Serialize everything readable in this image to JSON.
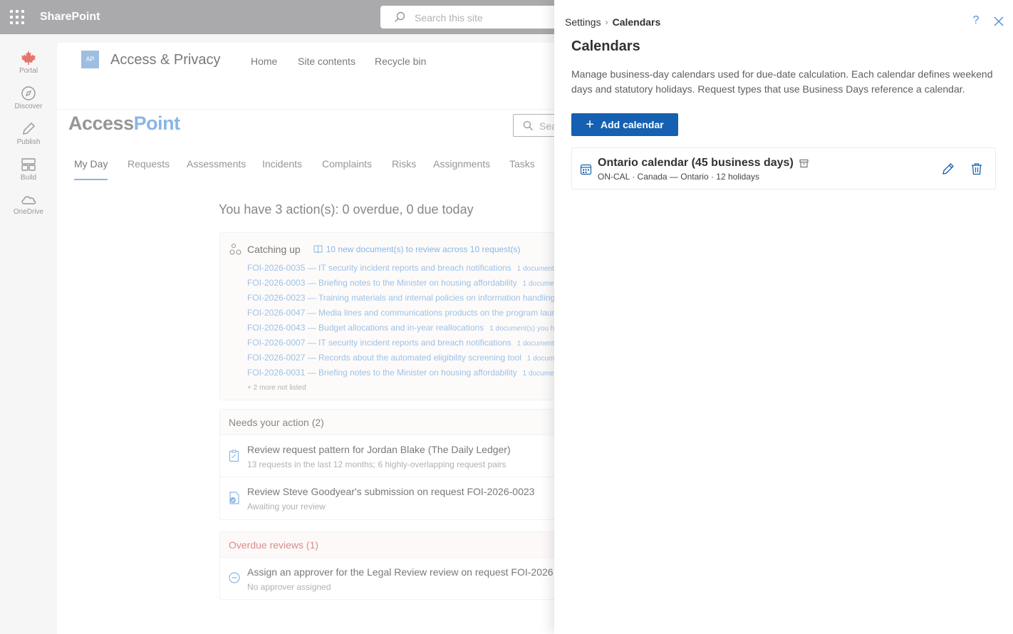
{
  "suite": {
    "brand": "SharePoint",
    "search_placeholder": "Search this site"
  },
  "rail": [
    {
      "label": "Portal",
      "icon": "maple-leaf-icon"
    },
    {
      "label": "Discover",
      "icon": "compass-icon"
    },
    {
      "label": "Publish",
      "icon": "pen-icon"
    },
    {
      "label": "Build",
      "icon": "layout-icon"
    },
    {
      "label": "OneDrive",
      "icon": "cloud-icon"
    }
  ],
  "site": {
    "logo_initials": "AP",
    "title": "Access & Privacy",
    "nav": [
      "Home",
      "Site contents",
      "Recycle bin"
    ],
    "app_logo_part1": "Access",
    "app_logo_part2": "Point",
    "inner_search_placeholder": "Sea",
    "tabs": [
      "My Day",
      "Requests",
      "Assessments",
      "Incidents",
      "Complaints",
      "Risks",
      "Assignments",
      "Tasks"
    ],
    "active_tab": "My Day",
    "summary": "You have 3 action(s): 0 overdue, 0 due today",
    "catching_up": {
      "title": "Catching up",
      "link": "10 new document(s) to review across 10 request(s)",
      "items": [
        {
          "text": "FOI-2026-0035 — IT security incident reports and breach notifications",
          "meta": "1 document"
        },
        {
          "text": "FOI-2026-0003 — Briefing notes to the Minister on housing affordability",
          "meta": "1 docume"
        },
        {
          "text": "FOI-2026-0023 — Training materials and internal policies on information handling",
          "meta": ""
        },
        {
          "text": "FOI-2026-0047 — Media lines and communications products on the program laun",
          "meta": ""
        },
        {
          "text": "FOI-2026-0043 — Budget allocations and in-year reallocations",
          "meta": "1 document(s) you ha"
        },
        {
          "text": "FOI-2026-0007 — IT security incident reports and breach notifications",
          "meta": "1 document"
        },
        {
          "text": "FOI-2026-0027 — Records about the automated eligibility screening tool",
          "meta": "1 docum"
        },
        {
          "text": "FOI-2026-0031 — Briefing notes to the Minister on housing affordability",
          "meta": "1 docume"
        }
      ],
      "more": "+ 2 more not listed"
    },
    "needs_action": {
      "title": "Needs your action (2)",
      "items": [
        {
          "title": "Review request pattern for Jordan Blake (The Daily Ledger)",
          "sub": "13 requests in the last 12 months; 6 highly-overlapping request pairs",
          "icon": "clipboard-icon"
        },
        {
          "title": "Review Steve Goodyear's submission on request FOI-2026-0023",
          "sub": "Awaiting your review",
          "icon": "document-check-icon"
        }
      ]
    },
    "overdue": {
      "title": "Overdue reviews (1)",
      "items": [
        {
          "title": "Assign an approver for the Legal Review review on request FOI-2026",
          "sub": "No approver assigned",
          "icon": "minus-circle-icon"
        }
      ]
    }
  },
  "panel": {
    "breadcrumb_root": "Settings",
    "breadcrumb_sep": "›",
    "breadcrumb_current": "Calendars",
    "help": "?",
    "title": "Calendars",
    "description": "Manage business-day calendars used for due-date calculation. Each calendar defines weekend days and statutory holidays. Request types that use Business Days reference a calendar.",
    "add_button": "Add calendar",
    "calendars": [
      {
        "name": "Ontario calendar (45 business days)",
        "sub": "ON-CAL · Canada — Ontario · 12 holidays"
      }
    ]
  },
  "colors": {
    "accent": "#1560b0",
    "link": "#4a90d9",
    "overdue": "#c0504d",
    "suitebar": "#7d7d80"
  }
}
